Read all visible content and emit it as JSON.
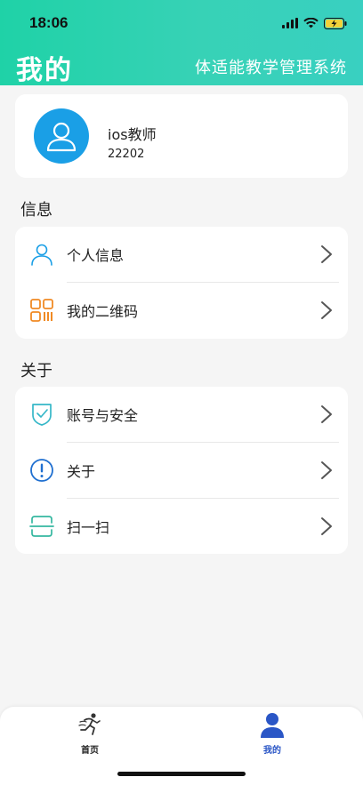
{
  "status_bar": {
    "time": "18:06"
  },
  "header": {
    "title": "我的",
    "app_name": "体适能教学管理系统"
  },
  "profile": {
    "name": "ios教师",
    "id": "22202"
  },
  "sections": {
    "info": {
      "title": "信息",
      "items": [
        {
          "label": "个人信息",
          "icon": "person-icon"
        },
        {
          "label": "我的二维码",
          "icon": "qr-code-icon"
        }
      ]
    },
    "about": {
      "title": "关于",
      "items": [
        {
          "label": "账号与安全",
          "icon": "shield-check-icon"
        },
        {
          "label": "关于",
          "icon": "info-exclamation-icon"
        },
        {
          "label": "扫一扫",
          "icon": "scan-icon"
        }
      ]
    }
  },
  "tab_bar": {
    "tabs": [
      {
        "label": "首页",
        "icon": "runner-icon",
        "active": false
      },
      {
        "label": "我的",
        "icon": "person-filled-icon",
        "active": true
      }
    ]
  },
  "colors": {
    "header_gradient_start": "#1fd2a7",
    "header_gradient_end": "#39d0c1",
    "avatar_blue": "#1a9fe6",
    "active_tab": "#2a56c6"
  }
}
